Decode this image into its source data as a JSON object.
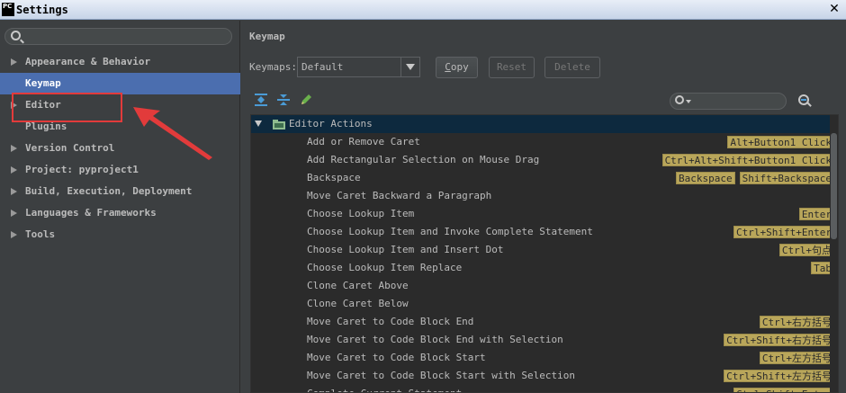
{
  "window": {
    "title": "Settings",
    "app_icon_text": "PC"
  },
  "search": {
    "placeholder": ""
  },
  "sidebar": {
    "items": [
      {
        "label": "Appearance & Behavior",
        "expandable": true
      },
      {
        "label": "Keymap",
        "expandable": false,
        "selected": true
      },
      {
        "label": "Editor",
        "expandable": true
      },
      {
        "label": "Plugins",
        "expandable": false
      },
      {
        "label": "Version Control",
        "expandable": true
      },
      {
        "label": "Project: pyproject1",
        "expandable": true
      },
      {
        "label": "Build, Execution, Deployment",
        "expandable": true
      },
      {
        "label": "Languages & Frameworks",
        "expandable": true
      },
      {
        "label": "Tools",
        "expandable": true
      }
    ]
  },
  "main": {
    "title": "Keymap",
    "keymaps_label": "Keymaps:",
    "keymap_selected": "Default",
    "buttons": {
      "copy": "opy",
      "copy_mnemonic": "C",
      "reset": "Reset",
      "delete": "Delete"
    },
    "tree": {
      "group": "Editor Actions",
      "rows": [
        {
          "name": "Add or Remove Caret",
          "keys": [
            "Alt+Button1 Click"
          ]
        },
        {
          "name": "Add Rectangular Selection on Mouse Drag",
          "keys": [
            "Ctrl+Alt+Shift+Button1 Click"
          ]
        },
        {
          "name": "Backspace",
          "keys": [
            "Backspace",
            "Shift+Backspace"
          ]
        },
        {
          "name": "Move Caret Backward a Paragraph",
          "keys": []
        },
        {
          "name": "Choose Lookup Item",
          "keys": [
            "Enter"
          ]
        },
        {
          "name": "Choose Lookup Item and Invoke Complete Statement",
          "keys": [
            "Ctrl+Shift+Enter"
          ]
        },
        {
          "name": "Choose Lookup Item and Insert Dot",
          "keys": [
            "Ctrl+句点"
          ]
        },
        {
          "name": "Choose Lookup Item Replace",
          "keys": [
            "Tab"
          ]
        },
        {
          "name": "Clone Caret Above",
          "keys": []
        },
        {
          "name": "Clone Caret Below",
          "keys": []
        },
        {
          "name": "Move Caret to Code Block End",
          "keys": [
            "Ctrl+右方括号"
          ]
        },
        {
          "name": "Move Caret to Code Block End with Selection",
          "keys": [
            "Ctrl+Shift+右方括号"
          ]
        },
        {
          "name": "Move Caret to Code Block Start",
          "keys": [
            "Ctrl+左方括号"
          ]
        },
        {
          "name": "Move Caret to Code Block Start with Selection",
          "keys": [
            "Ctrl+Shift+左方括号"
          ]
        },
        {
          "name": "Complete Current Statement",
          "keys": [
            "Ctrl+Shift+Enter"
          ]
        }
      ]
    }
  },
  "colors": {
    "selected": "#4b6eaf",
    "shortcut_bg": "#b9a65a",
    "annotation": "#e23b3b"
  }
}
